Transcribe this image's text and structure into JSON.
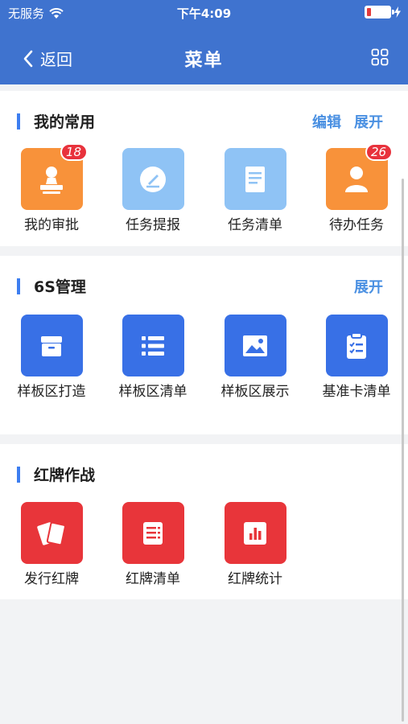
{
  "status": {
    "carrier": "无服务",
    "time": "下午4:09",
    "battery_level": 0.18
  },
  "nav": {
    "back_label": "返回",
    "title": "菜单",
    "grid_icon": "grid-icon"
  },
  "sections": {
    "common": {
      "title": "我的常用",
      "edit_label": "编辑",
      "expand_label": "展开",
      "items": [
        {
          "label": "我的审批",
          "icon": "stamp-icon",
          "color": "#f8923a",
          "badge": "18"
        },
        {
          "label": "任务提报",
          "icon": "pen-icon",
          "color": "#8fc3f5"
        },
        {
          "label": "任务清单",
          "icon": "document-icon",
          "color": "#8fc3f5"
        },
        {
          "label": "待办任务",
          "icon": "user-icon",
          "color": "#f8923a",
          "badge": "26"
        }
      ]
    },
    "mgmt6s": {
      "title": "6S管理",
      "expand_label": "展开",
      "items": [
        {
          "label": "样板区打造",
          "icon": "archive-icon",
          "color": "#3870e6"
        },
        {
          "label": "样板区清单",
          "icon": "list-icon",
          "color": "#3870e6"
        },
        {
          "label": "样板区展示",
          "icon": "image-icon",
          "color": "#3870e6"
        },
        {
          "label": "基准卡清单",
          "icon": "clipboard-icon",
          "color": "#3870e6"
        }
      ]
    },
    "redcard": {
      "title": "红牌作战",
      "items": [
        {
          "label": "发行红牌",
          "icon": "cards-icon",
          "color": "#e8353a"
        },
        {
          "label": "红牌清单",
          "icon": "list-doc-icon",
          "color": "#e8353a"
        },
        {
          "label": "红牌统计",
          "icon": "bar-chart-icon",
          "color": "#e8353a"
        }
      ]
    }
  }
}
